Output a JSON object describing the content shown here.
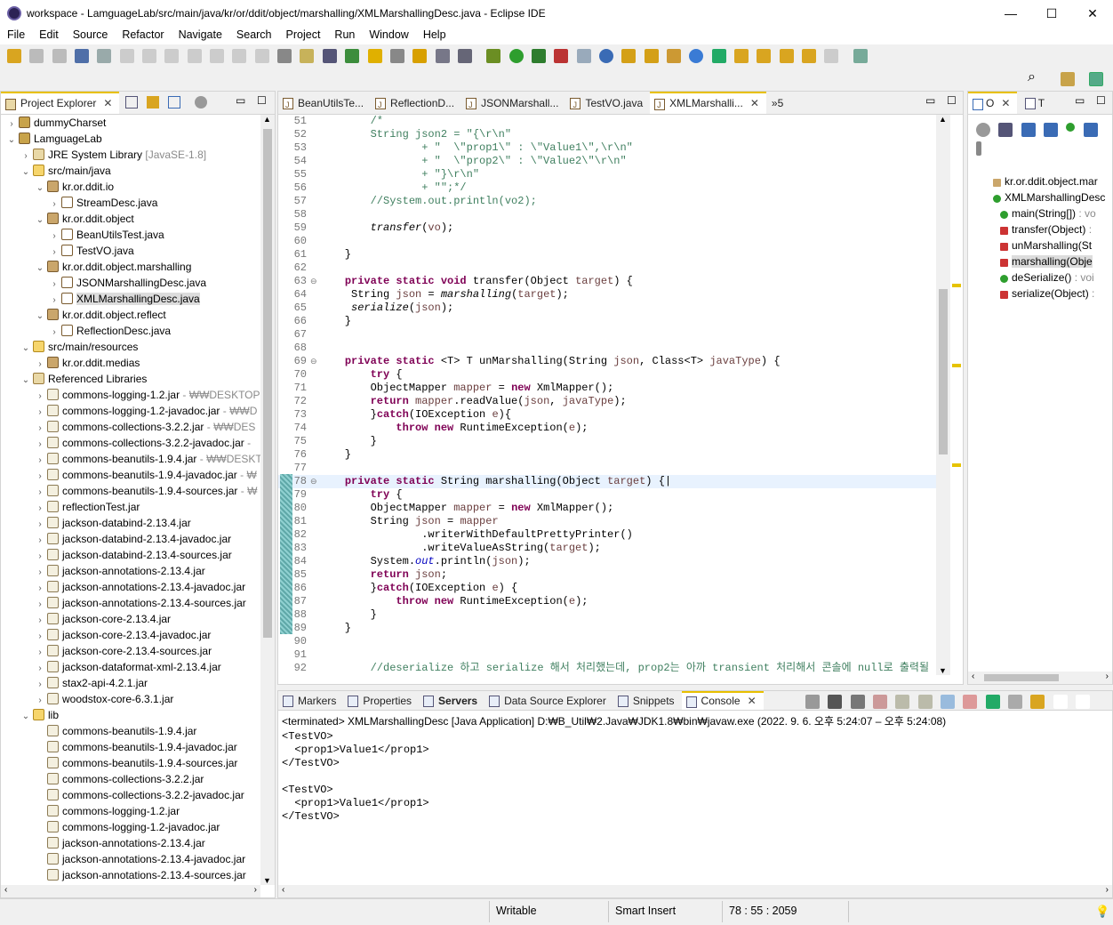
{
  "window": {
    "title": "workspace - LamguageLab/src/main/java/kr/or/ddit/object/marshalling/XMLMarshallingDesc.java - Eclipse IDE",
    "min": "—",
    "max": "☐",
    "close": "✕"
  },
  "menu": [
    "File",
    "Edit",
    "Source",
    "Refactor",
    "Navigate",
    "Search",
    "Project",
    "Run",
    "Window",
    "Help"
  ],
  "explorer": {
    "title": "Project Explorer",
    "tree": [
      {
        "d": 0,
        "a": "›",
        "i": "proj",
        "t": "dummyCharset"
      },
      {
        "d": 0,
        "a": "⌄",
        "i": "proj",
        "t": "LamguageLab"
      },
      {
        "d": 1,
        "a": "›",
        "i": "lib",
        "t": "JRE System Library",
        "x": "[JavaSE-1.8]"
      },
      {
        "d": 1,
        "a": "⌄",
        "i": "folder",
        "t": "src/main/java"
      },
      {
        "d": 2,
        "a": "⌄",
        "i": "pkg",
        "t": "kr.or.ddit.io"
      },
      {
        "d": 3,
        "a": "›",
        "i": "java",
        "t": "StreamDesc.java"
      },
      {
        "d": 2,
        "a": "⌄",
        "i": "pkg",
        "t": "kr.or.ddit.object"
      },
      {
        "d": 3,
        "a": "›",
        "i": "java",
        "t": "BeanUtilsTest.java"
      },
      {
        "d": 3,
        "a": "›",
        "i": "java",
        "t": "TestVO.java"
      },
      {
        "d": 2,
        "a": "⌄",
        "i": "pkg",
        "t": "kr.or.ddit.object.marshalling"
      },
      {
        "d": 3,
        "a": "›",
        "i": "java",
        "t": "JSONMarshallingDesc.java"
      },
      {
        "d": 3,
        "a": "›",
        "i": "java",
        "t": "XMLMarshallingDesc.java",
        "sel": true
      },
      {
        "d": 2,
        "a": "⌄",
        "i": "pkg",
        "t": "kr.or.ddit.object.reflect"
      },
      {
        "d": 3,
        "a": "›",
        "i": "java",
        "t": "ReflectionDesc.java"
      },
      {
        "d": 1,
        "a": "⌄",
        "i": "folder",
        "t": "src/main/resources"
      },
      {
        "d": 2,
        "a": "›",
        "i": "pkg",
        "t": "kr.or.ddit.medias"
      },
      {
        "d": 1,
        "a": "⌄",
        "i": "lib",
        "t": "Referenced Libraries"
      },
      {
        "d": 2,
        "a": "›",
        "i": "jar",
        "t": "commons-logging-1.2.jar",
        "x": "- ₩₩DESKTOP"
      },
      {
        "d": 2,
        "a": "›",
        "i": "jar",
        "t": "commons-logging-1.2-javadoc.jar",
        "x": "- ₩₩D"
      },
      {
        "d": 2,
        "a": "›",
        "i": "jar",
        "t": "commons-collections-3.2.2.jar",
        "x": "- ₩₩DES"
      },
      {
        "d": 2,
        "a": "›",
        "i": "jar",
        "t": "commons-collections-3.2.2-javadoc.jar",
        "x": "-"
      },
      {
        "d": 2,
        "a": "›",
        "i": "jar",
        "t": "commons-beanutils-1.9.4.jar",
        "x": "- ₩₩DESKT"
      },
      {
        "d": 2,
        "a": "›",
        "i": "jar",
        "t": "commons-beanutils-1.9.4-javadoc.jar",
        "x": "- ₩"
      },
      {
        "d": 2,
        "a": "›",
        "i": "jar",
        "t": "commons-beanutils-1.9.4-sources.jar",
        "x": "- ₩"
      },
      {
        "d": 2,
        "a": "›",
        "i": "jar",
        "t": "reflectionTest.jar"
      },
      {
        "d": 2,
        "a": "›",
        "i": "jar",
        "t": "jackson-databind-2.13.4.jar"
      },
      {
        "d": 2,
        "a": "›",
        "i": "jar",
        "t": "jackson-databind-2.13.4-javadoc.jar"
      },
      {
        "d": 2,
        "a": "›",
        "i": "jar",
        "t": "jackson-databind-2.13.4-sources.jar"
      },
      {
        "d": 2,
        "a": "›",
        "i": "jar",
        "t": "jackson-annotations-2.13.4.jar"
      },
      {
        "d": 2,
        "a": "›",
        "i": "jar",
        "t": "jackson-annotations-2.13.4-javadoc.jar"
      },
      {
        "d": 2,
        "a": "›",
        "i": "jar",
        "t": "jackson-annotations-2.13.4-sources.jar"
      },
      {
        "d": 2,
        "a": "›",
        "i": "jar",
        "t": "jackson-core-2.13.4.jar"
      },
      {
        "d": 2,
        "a": "›",
        "i": "jar",
        "t": "jackson-core-2.13.4-javadoc.jar"
      },
      {
        "d": 2,
        "a": "›",
        "i": "jar",
        "t": "jackson-core-2.13.4-sources.jar"
      },
      {
        "d": 2,
        "a": "›",
        "i": "jar",
        "t": "jackson-dataformat-xml-2.13.4.jar"
      },
      {
        "d": 2,
        "a": "›",
        "i": "jar",
        "t": "stax2-api-4.2.1.jar"
      },
      {
        "d": 2,
        "a": "›",
        "i": "jar",
        "t": "woodstox-core-6.3.1.jar"
      },
      {
        "d": 1,
        "a": "⌄",
        "i": "folder",
        "t": "lib"
      },
      {
        "d": 2,
        "a": "",
        "i": "jar",
        "t": "commons-beanutils-1.9.4.jar"
      },
      {
        "d": 2,
        "a": "",
        "i": "jar",
        "t": "commons-beanutils-1.9.4-javadoc.jar"
      },
      {
        "d": 2,
        "a": "",
        "i": "jar",
        "t": "commons-beanutils-1.9.4-sources.jar"
      },
      {
        "d": 2,
        "a": "",
        "i": "jar",
        "t": "commons-collections-3.2.2.jar"
      },
      {
        "d": 2,
        "a": "",
        "i": "jar",
        "t": "commons-collections-3.2.2-javadoc.jar"
      },
      {
        "d": 2,
        "a": "",
        "i": "jar",
        "t": "commons-logging-1.2.jar"
      },
      {
        "d": 2,
        "a": "",
        "i": "jar",
        "t": "commons-logging-1.2-javadoc.jar"
      },
      {
        "d": 2,
        "a": "",
        "i": "jar",
        "t": "jackson-annotations-2.13.4.jar"
      },
      {
        "d": 2,
        "a": "",
        "i": "jar",
        "t": "jackson-annotations-2.13.4-javadoc.jar"
      },
      {
        "d": 2,
        "a": "",
        "i": "jar",
        "t": "jackson-annotations-2.13.4-sources.jar"
      }
    ]
  },
  "editor": {
    "tabs": [
      {
        "t": "BeanUtilsTe..."
      },
      {
        "t": "ReflectionD..."
      },
      {
        "t": "JSONMarshall..."
      },
      {
        "t": "TestVO.java"
      },
      {
        "t": "XMLMarshalli...",
        "active": true
      }
    ],
    "overflow": "»5"
  },
  "code": [
    {
      "n": "51",
      "h": "        <span class='cm'>/*</span>"
    },
    {
      "n": "52",
      "h": "        <span class='cm'>String json2 = \"{\\r\\n\"</span>"
    },
    {
      "n": "53",
      "h": "                <span class='cm'>+ \"  \\\"prop1\\\" : \\\"Value1\\\",\\r\\n\"</span>"
    },
    {
      "n": "54",
      "h": "                <span class='cm'>+ \"  \\\"prop2\\\" : \\\"Value2\\\"\\r\\n\"</span>"
    },
    {
      "n": "55",
      "h": "                <span class='cm'>+ \"}\\r\\n\"</span>"
    },
    {
      "n": "56",
      "h": "                <span class='cm'>+ \"\";*/</span>"
    },
    {
      "n": "57",
      "h": "        <span class='cm'>//System.out.println(vo2);</span>"
    },
    {
      "n": "58",
      "h": ""
    },
    {
      "n": "59",
      "h": "        <span class='it'>transfer</span>(<span class='var'>vo</span>);"
    },
    {
      "n": "60",
      "h": ""
    },
    {
      "n": "61",
      "h": "    }"
    },
    {
      "n": "62",
      "h": ""
    },
    {
      "n": "63",
      "f": "⊖",
      "h": "    <span class='kw'>private static void</span> transfer(Object <span class='var'>target</span>) {"
    },
    {
      "n": "64",
      "h": "     String <span class='var'>json</span> = <span class='it'>marshalling</span>(<span class='var'>target</span>);"
    },
    {
      "n": "65",
      "h": "     <span class='it'>serialize</span>(<span class='var'>json</span>);"
    },
    {
      "n": "66",
      "h": "    }"
    },
    {
      "n": "67",
      "h": ""
    },
    {
      "n": "68",
      "h": ""
    },
    {
      "n": "69",
      "f": "⊖",
      "h": "    <span class='kw'>private static</span> &lt;T&gt; T unMarshalling(String <span class='var'>json</span>, Class&lt;T&gt; <span class='var'>javaType</span>) {"
    },
    {
      "n": "70",
      "h": "        <span class='kw'>try</span> {"
    },
    {
      "n": "71",
      "h": "        ObjectMapper <span class='var'>mapper</span> = <span class='kw'>new</span> XmlMapper();"
    },
    {
      "n": "72",
      "h": "        <span class='kw'>return</span> <span class='var'>mapper</span>.readValue(<span class='var'>json</span>, <span class='var'>javaType</span>);"
    },
    {
      "n": "73",
      "h": "        }<span class='kw'>catch</span>(IOException <span class='var'>e</span>){"
    },
    {
      "n": "74",
      "h": "            <span class='kw'>throw new</span> RuntimeException(<span class='var'>e</span>);"
    },
    {
      "n": "75",
      "h": "        }"
    },
    {
      "n": "76",
      "h": "    }"
    },
    {
      "n": "77",
      "h": ""
    },
    {
      "n": "78",
      "f": "⊖",
      "cur": true,
      "h": "    <span class='kw'>private static</span> String marshalling(Object <span class='var'>target</span>) {|"
    },
    {
      "n": "79",
      "h": "        <span class='kw'>try</span> {"
    },
    {
      "n": "80",
      "h": "        ObjectMapper <span class='var'>mapper</span> = <span class='kw'>new</span> XmlMapper();"
    },
    {
      "n": "81",
      "h": "        String <span class='var'>json</span> = <span class='var'>mapper</span>"
    },
    {
      "n": "82",
      "h": "                .writerWithDefaultPrettyPrinter()"
    },
    {
      "n": "83",
      "h": "                .writeValueAsString(<span class='var'>target</span>);"
    },
    {
      "n": "84",
      "h": "        System.<span class='fld it'>out</span>.println(<span class='var'>json</span>);"
    },
    {
      "n": "85",
      "h": "        <span class='kw'>return</span> <span class='var'>json</span>;"
    },
    {
      "n": "86",
      "h": "        }<span class='kw'>catch</span>(IOException <span class='var'>e</span>) {"
    },
    {
      "n": "87",
      "h": "            <span class='kw'>throw new</span> RuntimeException(<span class='var'>e</span>);"
    },
    {
      "n": "88",
      "h": "        }"
    },
    {
      "n": "89",
      "h": "    }"
    },
    {
      "n": "90",
      "h": ""
    },
    {
      "n": "91",
      "h": ""
    },
    {
      "n": "92",
      "h": "        <span class='cm'>//deserialize 하고 serialize 해서 처리했는데, prop2는 아까 transient 처리해서 콘솔에 null로 출력될 것</span>"
    }
  ],
  "outline": {
    "tab1": "O",
    "tab2": "T",
    "items": [
      {
        "d": 0,
        "t": "kr.or.ddit.object.mar",
        "ic": "pkg"
      },
      {
        "d": 0,
        "t": "XMLMarshallingDesc",
        "ic": "cls"
      },
      {
        "d": 1,
        "t": "main(String[])",
        "x": ": vo",
        "ic": "pub"
      },
      {
        "d": 1,
        "t": "transfer(Object)",
        "x": ":",
        "ic": "priv"
      },
      {
        "d": 1,
        "t": "unMarshalling(St",
        "ic": "priv"
      },
      {
        "d": 1,
        "t": "marshalling(Obje",
        "ic": "priv",
        "sel": true
      },
      {
        "d": 1,
        "t": "deSerialize()",
        "x": ": voi",
        "ic": "pub"
      },
      {
        "d": 1,
        "t": "serialize(Object)",
        "x": ":",
        "ic": "priv"
      }
    ]
  },
  "console": {
    "tabs": [
      {
        "t": "Markers"
      },
      {
        "t": "Properties"
      },
      {
        "t": "Servers",
        "bold": true
      },
      {
        "t": "Data Source Explorer"
      },
      {
        "t": "Snippets"
      },
      {
        "t": "Console",
        "active": true
      }
    ],
    "header": "<terminated> XMLMarshallingDesc [Java Application] D:₩B_Util₩2.Java₩JDK1.8₩bin₩javaw.exe  (2022. 9. 6. 오후 5:24:07 – 오후 5:24:08)",
    "output": "<TestVO>\n  <prop1>Value1</prop1>\n</TestVO>\n\n<TestVO>\n  <prop1>Value1</prop1>\n</TestVO>"
  },
  "status": {
    "mode": "Writable",
    "insert": "Smart Insert",
    "pos": "78 : 55 : 2059"
  }
}
